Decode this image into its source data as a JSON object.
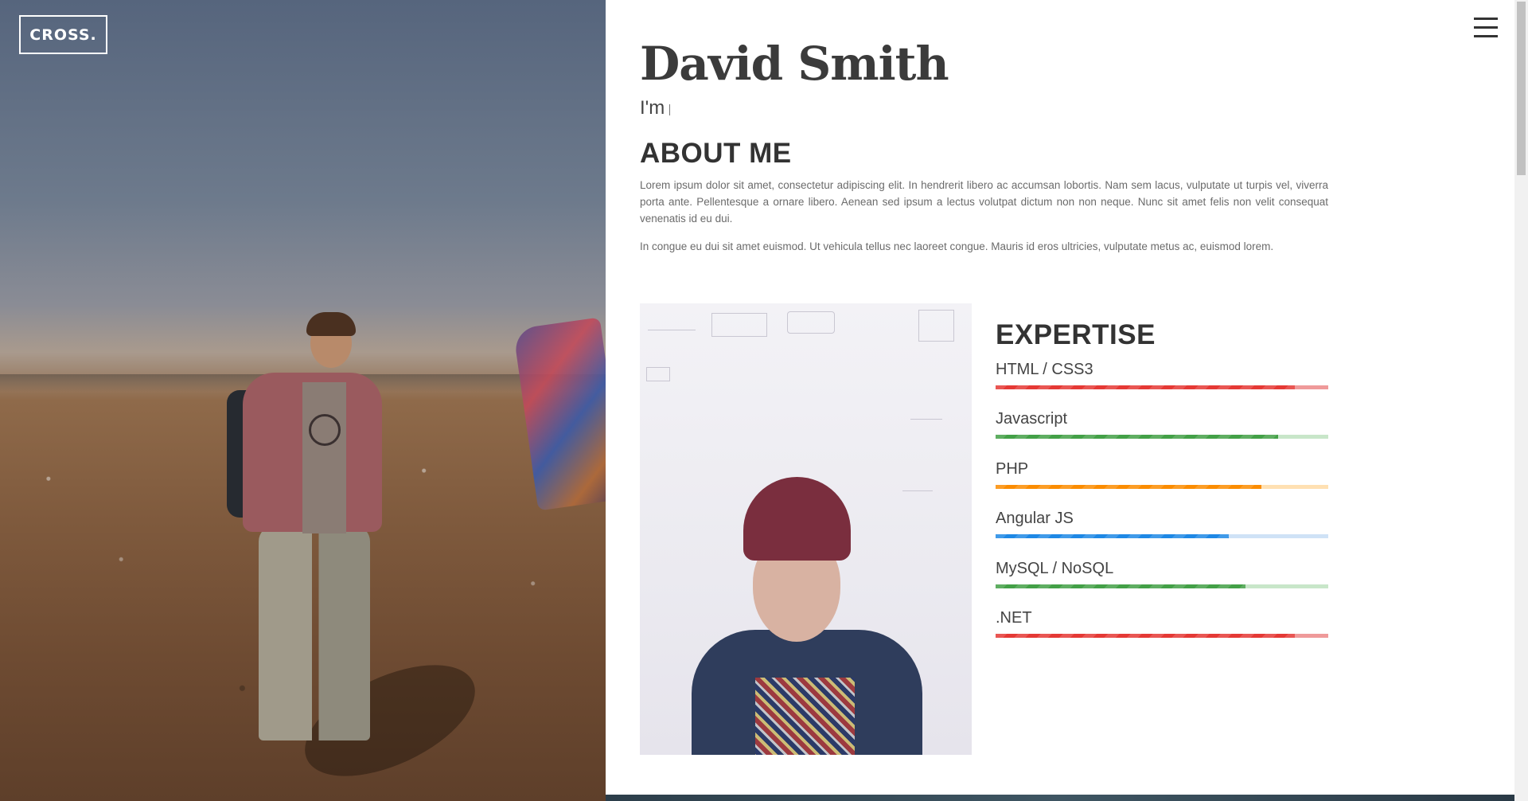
{
  "brand": {
    "logo_text": "CROSS."
  },
  "header": {
    "menu_icon": "hamburger-menu-icon"
  },
  "profile": {
    "name": "David Smith",
    "tagline": "I'm"
  },
  "about": {
    "title": "ABOUT ME",
    "paragraphs": [
      "Lorem ipsum dolor sit amet, consectetur adipiscing elit. In hendrerit libero ac accumsan lobortis. Nam sem lacus, vulputate ut turpis vel, viverra porta ante. Pellentesque a ornare libero. Aenean sed ipsum a lectus volutpat dictum non non neque. Nunc sit amet felis non velit consequat venenatis id eu dui.",
      "In congue eu dui sit amet euismod. Ut vehicula tellus nec laoreet congue. Mauris id eros ultricies, vulputate metus ac, euismod lorem."
    ]
  },
  "expertise": {
    "title": "EXPERTISE",
    "skills": [
      {
        "label": "HTML / CSS3",
        "percent": 90,
        "color": "#e53935",
        "track": "#ef9a9a"
      },
      {
        "label": "Javascript",
        "percent": 85,
        "color": "#43a047",
        "track": "#c8e6c9"
      },
      {
        "label": "PHP",
        "percent": 80,
        "color": "#fb8c00",
        "track": "#ffe0b2"
      },
      {
        "label": "Angular JS",
        "percent": 70,
        "color": "#1e88e5",
        "track": "#cfe2f6"
      },
      {
        "label": "MySQL / NoSQL",
        "percent": 75,
        "color": "#43a047",
        "track": "#c8e6c9"
      },
      {
        "label": ".NET",
        "percent": 90,
        "color": "#e53935",
        "track": "#ef9a9a"
      }
    ]
  }
}
